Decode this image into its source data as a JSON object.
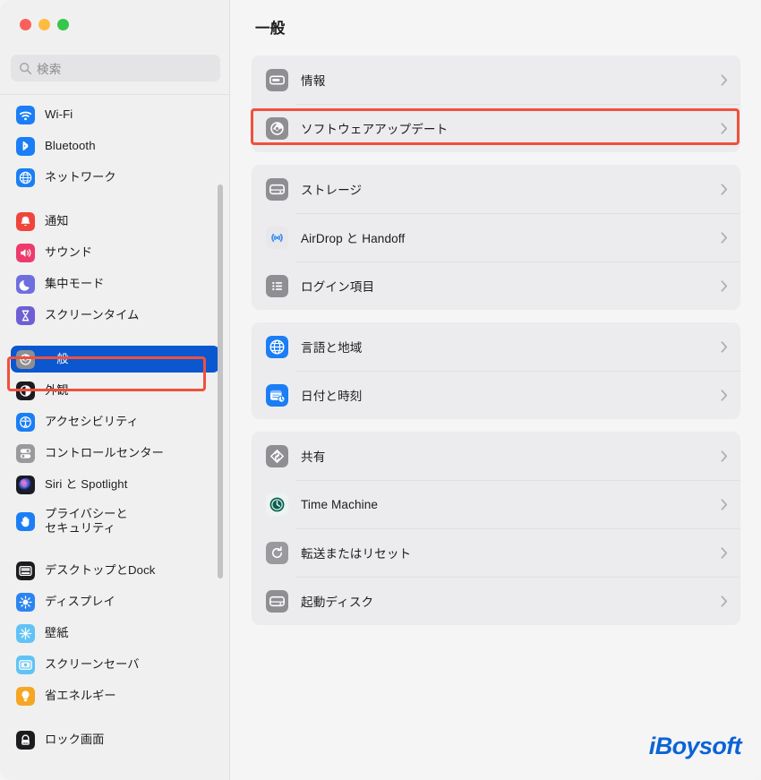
{
  "window": {
    "traffic_lights": [
      {
        "name": "close",
        "color": "#fc6058"
      },
      {
        "name": "minimize",
        "color": "#fdbc40"
      },
      {
        "name": "maximize",
        "color": "#34c749"
      }
    ]
  },
  "search": {
    "placeholder": "検索",
    "value": "",
    "icon": "search-icon"
  },
  "sidebar": {
    "selected": "一般",
    "selection_color": "#0b57d0",
    "groups": [
      {
        "items": [
          {
            "label": "Wi-Fi",
            "icon": "wifi-icon",
            "color": "#1b7ef5"
          },
          {
            "label": "Bluetooth",
            "icon": "bluetooth-icon",
            "color": "#1b7ef5"
          },
          {
            "label": "ネットワーク",
            "icon": "network-globe-icon",
            "color": "#1b7ef5"
          }
        ]
      },
      {
        "items": [
          {
            "label": "通知",
            "icon": "notifications-bell-icon",
            "color": "#f0453a"
          },
          {
            "label": "サウンド",
            "icon": "sound-speaker-icon",
            "color": "#ee3a6b"
          },
          {
            "label": "集中モード",
            "icon": "focus-moon-icon",
            "color": "#6e6ede"
          },
          {
            "label": "スクリーンタイム",
            "icon": "screen-time-hourglass-icon",
            "color": "#6f5fd4"
          }
        ]
      },
      {
        "items": [
          {
            "label": "一般",
            "icon": "general-gear-icon",
            "color": "#8e8e93",
            "selected": true
          },
          {
            "label": "外観",
            "icon": "appearance-icon",
            "color": "#1c1c1e"
          },
          {
            "label": "アクセシビリティ",
            "icon": "accessibility-icon",
            "color": "#1b7ef5"
          },
          {
            "label": "コントロールセンター",
            "icon": "control-center-icon",
            "color": "#9a9a9e"
          },
          {
            "label": "Siri と Spotlight",
            "icon": "siri-icon",
            "color": "#2b2b33"
          },
          {
            "label": "プライバシーと\nセキュリティ",
            "icon": "privacy-hand-icon",
            "color": "#1b7ef5",
            "two_line": true
          }
        ]
      },
      {
        "items": [
          {
            "label": "デスクトップとDock",
            "icon": "desktop-dock-icon",
            "color": "#1c1c1e"
          },
          {
            "label": "ディスプレイ",
            "icon": "display-icon",
            "color": "#2b85f0"
          },
          {
            "label": "壁紙",
            "icon": "wallpaper-icon",
            "color": "#61c3f5"
          },
          {
            "label": "スクリーンセーバ",
            "icon": "screensaver-icon",
            "color": "#61c3f5"
          },
          {
            "label": "省エネルギー",
            "icon": "energy-saver-bulb-icon",
            "color": "#f5a623"
          }
        ]
      },
      {
        "items": [
          {
            "label": "ロック画面",
            "icon": "lock-screen-icon",
            "color": "#1c1c1e"
          }
        ]
      }
    ]
  },
  "main": {
    "title": "一般",
    "groups": [
      {
        "rows": [
          {
            "label": "情報",
            "icon": "about-info-icon",
            "color": "#8e8e93",
            "chevron": "chevron-right-icon"
          },
          {
            "label": "ソフトウェアアップデート",
            "icon": "software-update-icon",
            "color": "#8e8e93",
            "chevron": "chevron-right-icon",
            "highlighted": true
          }
        ]
      },
      {
        "rows": [
          {
            "label": "ストレージ",
            "icon": "storage-drive-icon",
            "color": "#8e8e93",
            "chevron": "chevron-right-icon"
          },
          {
            "label": "AirDrop と Handoff",
            "icon": "airdrop-icon",
            "color": "#3b8ff0",
            "chevron": "chevron-right-icon"
          },
          {
            "label": "ログイン項目",
            "icon": "login-items-list-icon",
            "color": "#8e8e93",
            "chevron": "chevron-right-icon"
          }
        ]
      },
      {
        "rows": [
          {
            "label": "言語と地域",
            "icon": "language-region-globe-icon",
            "color": "#1b7ef5",
            "chevron": "chevron-right-icon"
          },
          {
            "label": "日付と時刻",
            "icon": "date-time-icon",
            "color": "#1b7ef5",
            "chevron": "chevron-right-icon"
          }
        ]
      },
      {
        "rows": [
          {
            "label": "共有",
            "icon": "sharing-icon",
            "color": "#8e8e93",
            "chevron": "chevron-right-icon"
          },
          {
            "label": "Time Machine",
            "icon": "time-machine-icon",
            "color": "#0d5c4e",
            "chevron": "chevron-right-icon"
          },
          {
            "label": "転送またはリセット",
            "icon": "transfer-reset-icon",
            "color": "#9a9a9e",
            "chevron": "chevron-right-icon"
          },
          {
            "label": "起動ディスク",
            "icon": "startup-disk-icon",
            "color": "#8e8e93",
            "chevron": "chevron-right-icon"
          }
        ]
      }
    ]
  },
  "annotations": [
    {
      "name": "general-highlight-box",
      "color": "#f0503c",
      "target": "一般"
    },
    {
      "name": "software-update-highlight-box",
      "color": "#f0503c",
      "target": "ソフトウェアアップデート"
    }
  ],
  "watermark": {
    "text": "iBoysoft",
    "color": "#0b63d6"
  }
}
